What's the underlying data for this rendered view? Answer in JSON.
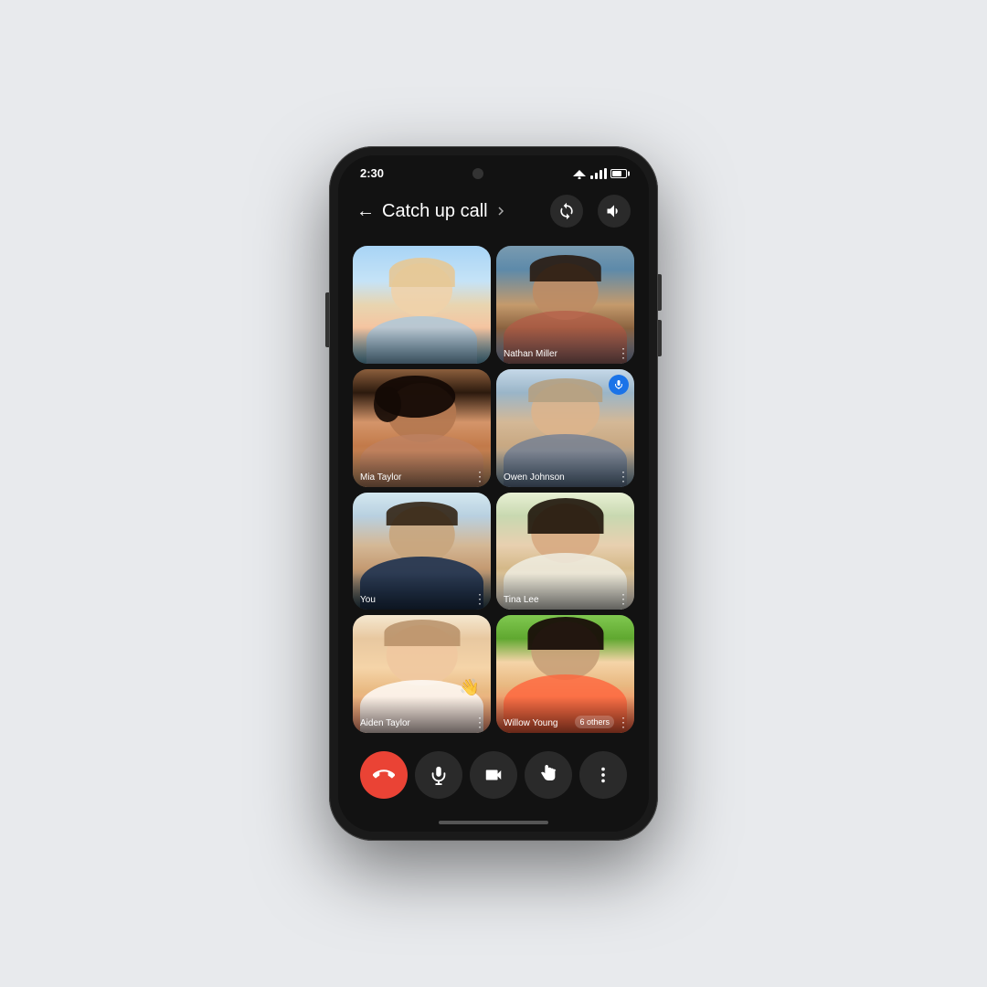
{
  "page": {
    "background": "#e8eaed"
  },
  "statusBar": {
    "time": "2:30",
    "signal": "full"
  },
  "header": {
    "backLabel": "←",
    "title": "Catch up call",
    "chevron": "▶",
    "rotateIcon": "↺",
    "audioIcon": "🔊"
  },
  "participants": [
    {
      "id": 1,
      "name": "",
      "hasBadge": false,
      "class": "tile-1"
    },
    {
      "id": 2,
      "name": "Nathan Miller",
      "hasBadge": false,
      "class": "tile-2"
    },
    {
      "id": 3,
      "name": "Mia Taylor",
      "hasBadge": false,
      "class": "tile-3"
    },
    {
      "id": 4,
      "name": "Owen Johnson",
      "hasBadge": true,
      "class": "tile-4"
    },
    {
      "id": 5,
      "name": "You",
      "hasBadge": false,
      "class": "tile-5"
    },
    {
      "id": 6,
      "name": "Tina Lee",
      "hasBadge": false,
      "class": "tile-6"
    },
    {
      "id": 7,
      "name": "Aiden Taylor",
      "hasBadge": false,
      "class": "tile-7"
    },
    {
      "id": 8,
      "name": "Willow Young",
      "hasBadge": false,
      "othersCount": "6 others",
      "class": "tile-8"
    }
  ],
  "controls": {
    "endCall": "📞",
    "mute": "🎤",
    "video": "📹",
    "hand": "✋",
    "more": "⋮"
  }
}
